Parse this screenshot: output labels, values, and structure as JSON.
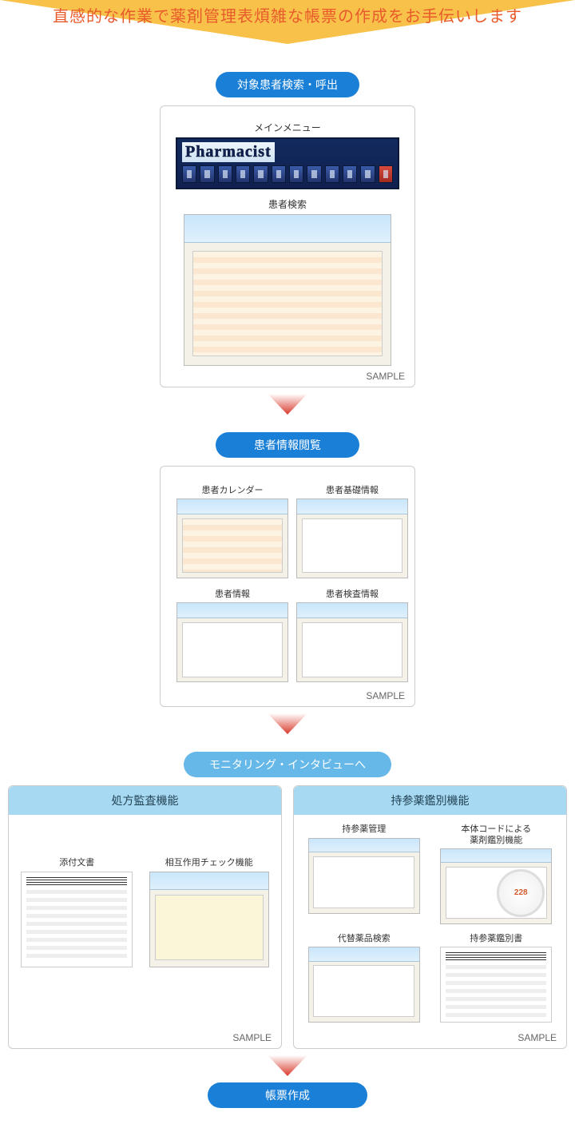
{
  "headline": "直感的な作業で薬剤管理表煩雑な帳票の作成をお手伝いします",
  "steps": {
    "s1_pill": "対象患者検索・呼出",
    "s2_pill": "患者情報閲覧",
    "s3_pill": "モニタリング・インタビューへ",
    "s4_pill": "帳票作成"
  },
  "card1": {
    "main_menu_label": "メインメニュー",
    "app_title": "Pharmacist",
    "patient_search_label": "患者検索"
  },
  "card2": {
    "calendar": "患者カレンダー",
    "basic_info": "患者基礎情報",
    "patient_info": "患者情報",
    "exam_info": "患者検査情報"
  },
  "secA": {
    "header": "処方監査機能",
    "doc": "添付文書",
    "interaction": "相互作用チェック機能"
  },
  "secB": {
    "header": "持参薬鑑別機能",
    "manage": "持参薬管理",
    "bycode": "本体コードによる\n薬剤鑑別機能",
    "alt": "代替薬品検索",
    "report": "持参薬鑑別書",
    "gauge_value": "228"
  },
  "sample_label": "SAMPLE"
}
